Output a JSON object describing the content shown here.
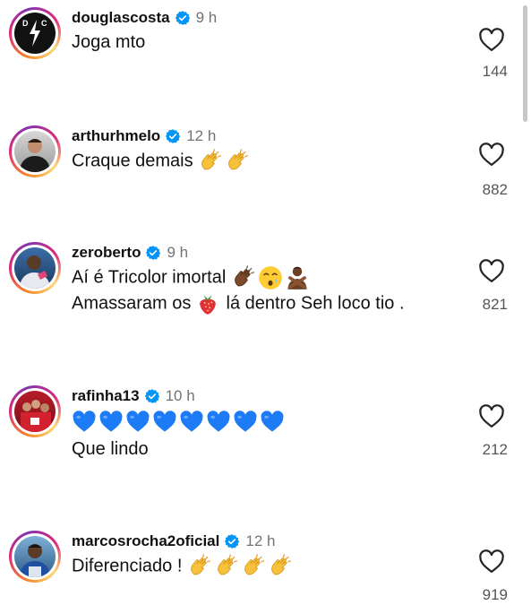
{
  "comments": [
    {
      "username": "douglascosta",
      "time": "9 h",
      "text": "Joga mto",
      "likes": "144"
    },
    {
      "username": "arthurhmelo",
      "time": "12 h",
      "text": "Craque demais",
      "likes": "882"
    },
    {
      "username": "zeroberto",
      "time": "9 h",
      "text": "Aí é Tricolor imortal",
      "text2a": "Amassaram os",
      "text2b": "lá dentro Seh loco tio .",
      "likes": "821"
    },
    {
      "username": "rafinha13",
      "time": "10 h",
      "text2": "Que lindo",
      "likes": "212"
    },
    {
      "username": "marcosrocha2oficial",
      "time": "12 h",
      "text": "Diferenciado !",
      "likes": "919"
    }
  ],
  "icons": {
    "verified": "verified-badge-icon",
    "like": "heart-outline-icon",
    "clap": "clapping-hands-emoji",
    "blue_heart": "blue-heart-emoji",
    "strawberry": "strawberry-emoji"
  },
  "colors": {
    "verified": "#0095f6",
    "time": "#737373",
    "blue_heart": "#1d7bf5"
  }
}
